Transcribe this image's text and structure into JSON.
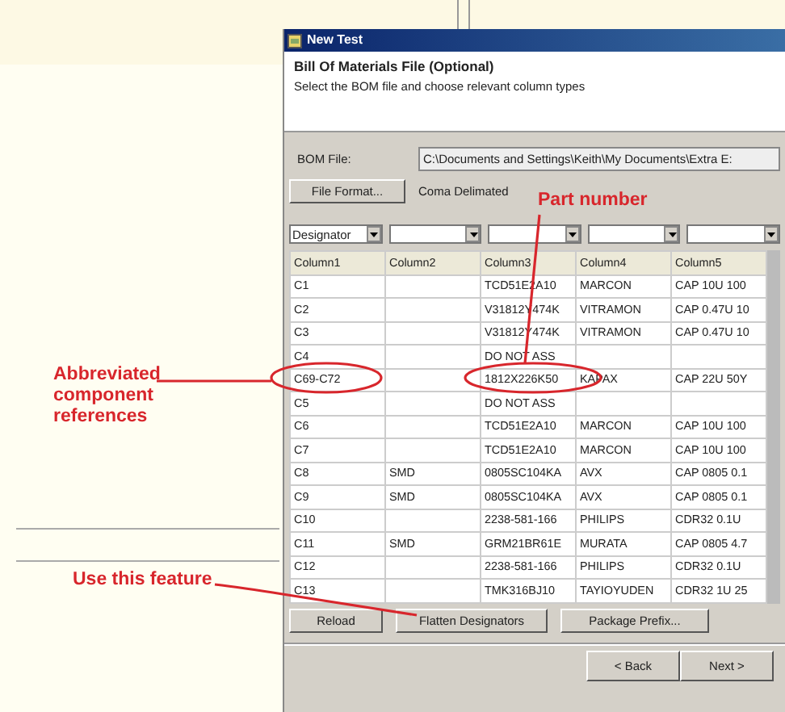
{
  "window": {
    "title": "New Test"
  },
  "header": {
    "title": "Bill Of Materials File (Optional)",
    "subtitle": "Select the BOM file and choose relevant column types"
  },
  "bom_file": {
    "label": "BOM File:",
    "value": "C:\\Documents and Settings\\Keith\\My Documents\\Extra E:"
  },
  "file_format": {
    "button": "File Format...",
    "value": "Coma Delimated"
  },
  "column_type_selectors": [
    "Designator"
  ],
  "table": {
    "columns": [
      "Column1",
      "Column2",
      "Column3",
      "Column4",
      "Column5"
    ],
    "rows": [
      [
        "C1",
        "",
        "TCD51E2A10",
        "MARCON",
        "CAP 10U 100"
      ],
      [
        "C2",
        "",
        "V31812Y474K",
        "VITRAMON",
        "CAP 0.47U 10"
      ],
      [
        "C3",
        "",
        "V31812Y474K",
        "VITRAMON",
        "CAP 0.47U 10"
      ],
      [
        "C4",
        "",
        "DO NOT ASS",
        "",
        ""
      ],
      [
        "C69-C72",
        "",
        "1812X226K50",
        "KAPAX",
        "CAP 22U 50Y"
      ],
      [
        "C5",
        "",
        "DO NOT ASS",
        "",
        ""
      ],
      [
        "C6",
        "",
        "TCD51E2A10",
        "MARCON",
        "CAP 10U 100"
      ],
      [
        "C7",
        "",
        "TCD51E2A10",
        "MARCON",
        "CAP 10U 100"
      ],
      [
        "C8",
        "SMD",
        "0805SC104KA",
        "AVX",
        "CAP 0805 0.1"
      ],
      [
        "C9",
        "SMD",
        "0805SC104KA",
        "AVX",
        "CAP 0805 0.1"
      ],
      [
        "C10",
        "",
        "2238-581-166",
        "PHILIPS",
        "CDR32 0.1U"
      ],
      [
        "C11",
        "SMD",
        "GRM21BR61E",
        "MURATA",
        "CAP 0805 4.7"
      ],
      [
        "C12",
        "",
        "2238-581-166",
        "PHILIPS",
        "CDR32 0.1U"
      ],
      [
        "C13",
        "",
        "TMK316BJ10",
        "TAYIOYUDEN",
        "CDR32 1U 25"
      ]
    ]
  },
  "actions": [
    "Reload",
    "Flatten Designators",
    "Package Prefix..."
  ],
  "nav_buttons": [
    "< Back",
    "Next >"
  ],
  "annotations": [
    {
      "kind": "part",
      "text": "Part number"
    },
    {
      "kind": "designator",
      "text": "Abbreviated component references"
    },
    {
      "kind": "feature",
      "text": "Use this feature"
    }
  ]
}
